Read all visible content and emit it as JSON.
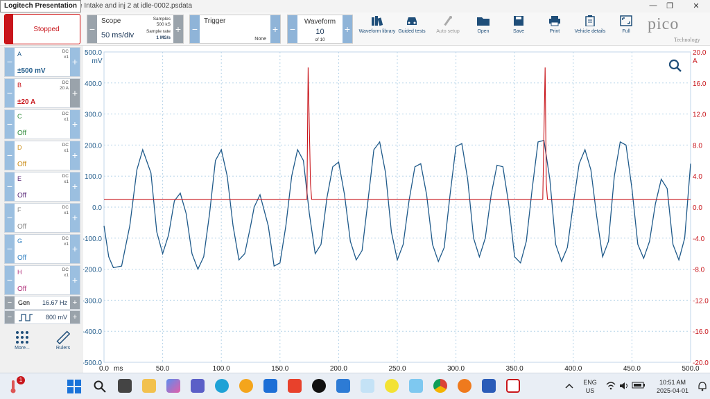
{
  "window": {
    "title_overlay": "Logitech Presentation",
    "file_title": "ve Intake and inj 2 at idle-0002.psdata",
    "minimize": "—",
    "maximize": "❐",
    "close": "✕"
  },
  "toolbar": {
    "status_label": "Stopped",
    "scope": {
      "label": "Scope",
      "timebase": "50 ms/div",
      "samples_label": "Samples",
      "samples_value": "500 kS",
      "rate_label": "Sample rate",
      "rate_value": "1 MS/s"
    },
    "trigger": {
      "label": "Trigger",
      "mode": "None"
    },
    "waveform": {
      "label": "Waveform",
      "current": "10",
      "of": "of 10"
    },
    "tools": [
      {
        "label": "Waveform library",
        "icon": "books-icon",
        "enabled": true
      },
      {
        "label": "Guided tests",
        "icon": "car-icon",
        "enabled": true
      },
      {
        "label": "Auto setup",
        "icon": "wand-icon",
        "enabled": false
      },
      {
        "label": "Open",
        "icon": "folder-icon",
        "enabled": true
      },
      {
        "label": "Save",
        "icon": "floppy-icon",
        "enabled": true
      },
      {
        "label": "Print",
        "icon": "printer-icon",
        "enabled": true
      },
      {
        "label": "Vehicle details",
        "icon": "clipboard-icon",
        "enabled": true
      },
      {
        "label": "Full",
        "icon": "fullscreen-icon",
        "enabled": true
      }
    ],
    "brand": {
      "name": "pico",
      "sub": "Technology"
    }
  },
  "channels": [
    {
      "name": "A",
      "coupling": "DC",
      "probe": "x1",
      "range": "±500 mV",
      "color": "#1f5a8a",
      "active": true
    },
    {
      "name": "B",
      "coupling": "DC",
      "probe": "20 A",
      "range": "±20 A",
      "color": "#c8151b",
      "active": true
    },
    {
      "name": "C",
      "coupling": "DC",
      "probe": "x1",
      "range": "Off",
      "color": "#2e8b3a",
      "active": false
    },
    {
      "name": "D",
      "coupling": "DC",
      "probe": "x1",
      "range": "Off",
      "color": "#c98a12",
      "active": false
    },
    {
      "name": "E",
      "coupling": "DC",
      "probe": "x1",
      "range": "Off",
      "color": "#5a2a7a",
      "active": false
    },
    {
      "name": "F",
      "coupling": "DC",
      "probe": "x1",
      "range": "Off",
      "color": "#888888",
      "active": false
    },
    {
      "name": "G",
      "coupling": "DC",
      "probe": "x1",
      "range": "Off",
      "color": "#2f7fc0",
      "active": false
    },
    {
      "name": "H",
      "coupling": "DC",
      "probe": "x1",
      "range": "Off",
      "color": "#b0307a",
      "active": false
    }
  ],
  "generator": {
    "label": "Gen",
    "frequency": "16.67 Hz",
    "amplitude": "800 mV"
  },
  "side_tools": [
    {
      "label": "More...",
      "icon": "grid-dots-icon"
    },
    {
      "label": "Rulers",
      "icon": "ruler-icon"
    }
  ],
  "chart_data": {
    "type": "line",
    "xlim": [
      0,
      500
    ],
    "x_unit": "ms",
    "x_ticks": [
      "0.0",
      "50.0",
      "100.0",
      "150.0",
      "200.0",
      "250.0",
      "300.0",
      "350.0",
      "400.0",
      "450.0",
      "500.0"
    ],
    "left_axis": {
      "unit": "mV",
      "range": [
        -500,
        500
      ],
      "ticks": [
        "500.0",
        "400.0",
        "300.0",
        "200.0",
        "100.0",
        "0.0",
        "-100.0",
        "-200.0",
        "-300.0",
        "-400.0",
        "-500.0"
      ],
      "color": "#1f5a8a"
    },
    "right_axis": {
      "unit": "A",
      "range": [
        -20,
        20
      ],
      "ticks": [
        "20.0",
        "16.0",
        "12.0",
        "8.0",
        "4.0",
        "0.0",
        "-4.0",
        "-8.0",
        "-12.0",
        "-16.0",
        "-20.0"
      ],
      "color": "#c8151b"
    },
    "grid": true,
    "series": [
      {
        "channel": "A",
        "color": "#1f5a8a",
        "x": [
          0,
          4,
          8,
          15,
          22,
          28,
          33,
          40,
          45,
          50,
          55,
          60,
          65,
          70,
          75,
          80,
          85,
          90,
          95,
          100,
          105,
          110,
          115,
          120,
          125,
          128,
          133,
          140,
          145,
          150,
          155,
          160,
          165,
          170,
          175,
          180,
          185,
          190,
          195,
          200,
          205,
          210,
          215,
          220,
          225,
          230,
          235,
          240,
          245,
          250,
          255,
          260,
          265,
          270,
          275,
          280,
          285,
          290,
          295,
          300,
          305,
          310,
          315,
          320,
          325,
          330,
          335,
          340,
          345,
          350,
          355,
          360,
          365,
          370,
          375,
          380,
          385,
          390,
          395,
          400,
          405,
          410,
          415,
          420,
          425,
          430,
          435,
          440,
          445,
          450,
          455,
          460,
          465,
          470,
          475,
          480,
          485,
          490,
          495,
          500
        ],
        "y": [
          -60,
          -160,
          -195,
          -190,
          -60,
          120,
          185,
          110,
          -80,
          -150,
          -90,
          20,
          45,
          -20,
          -150,
          -200,
          -160,
          -20,
          150,
          185,
          100,
          -60,
          -170,
          -150,
          -60,
          0,
          40,
          -60,
          -190,
          -180,
          -60,
          100,
          185,
          150,
          -20,
          -150,
          -120,
          30,
          130,
          145,
          40,
          -110,
          -170,
          -140,
          20,
          185,
          210,
          110,
          -80,
          -170,
          -120,
          20,
          130,
          140,
          40,
          -120,
          -175,
          -130,
          40,
          195,
          205,
          90,
          -100,
          -160,
          -100,
          40,
          135,
          130,
          10,
          -160,
          -180,
          -110,
          60,
          210,
          215,
          90,
          -120,
          -175,
          -130,
          10,
          140,
          185,
          120,
          -30,
          -160,
          -110,
          100,
          210,
          200,
          60,
          -120,
          -165,
          -110,
          10,
          90,
          60,
          -120,
          -170,
          -100,
          140
        ]
      },
      {
        "channel": "B",
        "color": "#c8151b",
        "x": [
          0,
          170,
          173,
          174,
          176,
          177,
          178,
          180,
          370,
          373,
          374,
          376,
          377,
          378,
          380,
          500
        ],
        "y": [
          1.0,
          1.0,
          1.0,
          18.0,
          3.0,
          1.0,
          1.0,
          1.0,
          1.0,
          1.0,
          1.0,
          18.0,
          3.0,
          1.0,
          1.0,
          1.0
        ]
      }
    ]
  },
  "taskbar": {
    "badge": "1",
    "lang_top": "ENG",
    "lang_bottom": "US",
    "time": "10:51 AM",
    "date": "2025-04-01"
  }
}
